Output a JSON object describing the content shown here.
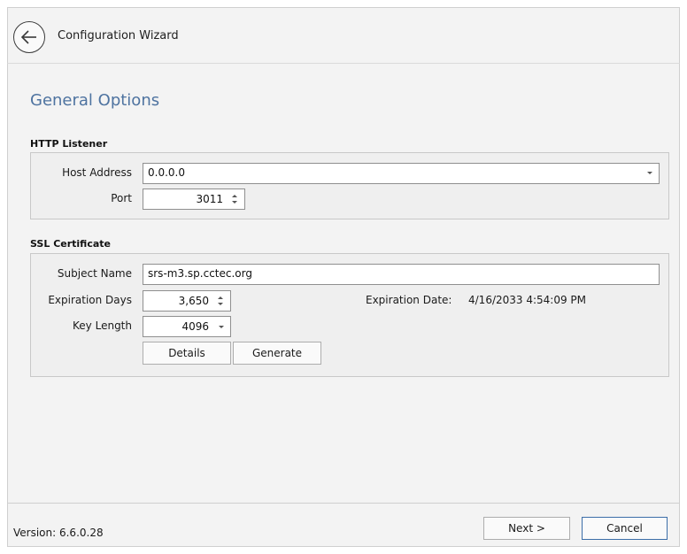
{
  "header": {
    "title": "Configuration Wizard",
    "back_icon": "arrow-left-icon"
  },
  "page": {
    "title": "General Options"
  },
  "http_listener": {
    "section_label": "HTTP Listener",
    "host_address_label": "Host Address",
    "host_address_value": "0.0.0.0",
    "port_label": "Port",
    "port_value": "3011"
  },
  "ssl_certificate": {
    "section_label": "SSL Certificate",
    "subject_name_label": "Subject Name",
    "subject_name_value": "srs-m3.sp.cctec.org",
    "expiration_days_label": "Expiration Days",
    "expiration_days_value": "3,650",
    "expiration_date_label": "Expiration Date:",
    "expiration_date_value": "4/16/2033 4:54:09 PM",
    "key_length_label": "Key Length",
    "key_length_value": "4096",
    "details_label": "Details",
    "generate_label": "Generate"
  },
  "footer": {
    "version": "Version: 6.6.0.28",
    "next_label": "Next >",
    "cancel_label": "Cancel"
  },
  "colors": {
    "title_blue": "#4e73a0",
    "panel_bg": "#f3f3f3",
    "primary_border": "#3c6ea8"
  }
}
